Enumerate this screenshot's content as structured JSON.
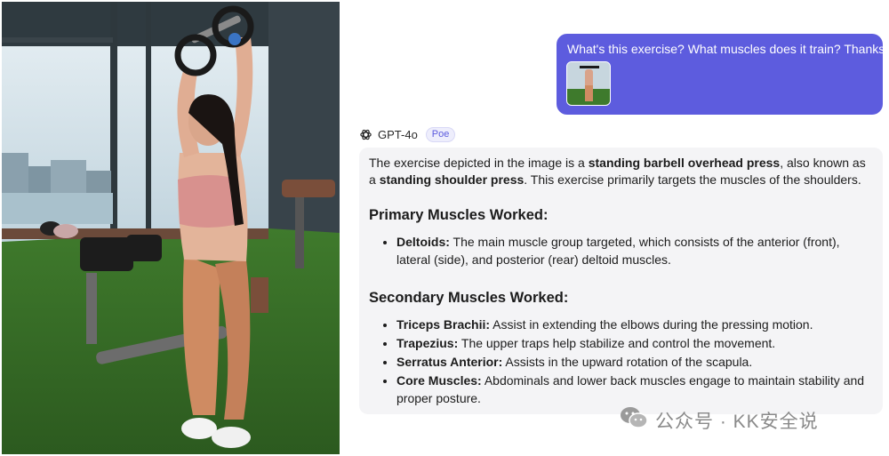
{
  "user_message": {
    "text": "What's this exercise? What muscles does it train? Thanks"
  },
  "bot": {
    "name": "GPT-4o",
    "badge": "Poe",
    "intro": {
      "p1": "The exercise depicted in the image is a ",
      "b1": "standing barbell overhead press",
      "p2": ", also known as a ",
      "b2": "standing shoulder press",
      "p3": ". This exercise primarily targets the muscles of the shoulders."
    },
    "primary_heading": "Primary Muscles Worked:",
    "primary": [
      {
        "term": "Deltoids:",
        "desc": " The main muscle group targeted, which consists of the anterior (front), lateral (side), and posterior (rear) deltoid muscles."
      }
    ],
    "secondary_heading": "Secondary Muscles Worked:",
    "secondary": [
      {
        "term": "Triceps Brachii:",
        "desc": " Assist in extending the elbows during the pressing motion."
      },
      {
        "term": "Trapezius:",
        "desc": " The upper traps help stabilize and control the movement."
      },
      {
        "term": "Serratus Anterior:",
        "desc": " Assists in the upward rotation of the scapula."
      },
      {
        "term": "Core Muscles:",
        "desc": " Abdominals and lower back muscles engage to maintain stability and proper posture."
      }
    ]
  },
  "watermark": {
    "text": "公众号 · KK安全说"
  },
  "colors": {
    "user_bubble": "#5d5cde",
    "answer_bg": "#f4f4f6",
    "watermark": "#8a8a8a"
  },
  "icons": {
    "bot_avatar": "openai-logo-icon",
    "watermark_logo": "wechat-icon"
  }
}
